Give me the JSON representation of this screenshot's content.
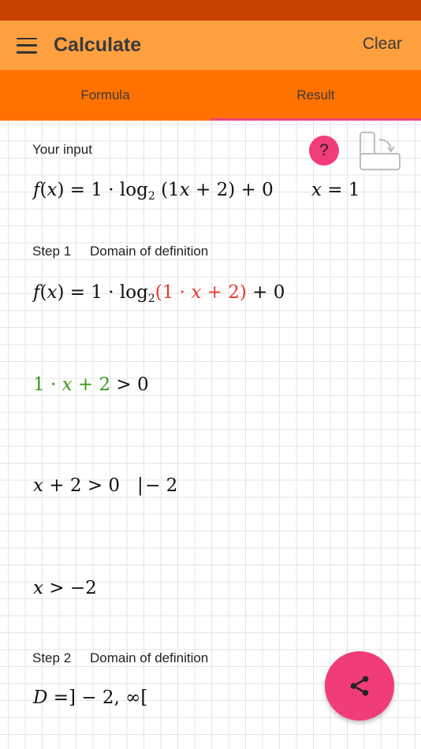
{
  "app_bar": {
    "title": "Calculate",
    "clear_label": "Clear"
  },
  "tabs": [
    {
      "label": "Formula",
      "active": false
    },
    {
      "label": "Result",
      "active": true
    }
  ],
  "your_input": {
    "label": "Your input",
    "help_label": "?"
  },
  "steps": [
    {
      "number": "Step 1",
      "title": "Domain of definition"
    },
    {
      "number": "Step 2",
      "title": "Domain of definition"
    }
  ],
  "colors": {
    "status_bar": "#c94100",
    "app_bar": "#ffa040",
    "tab_bar": "#ff7200",
    "accent": "#f03c78",
    "highlight_red": "#e53935",
    "highlight_green": "#3a9a1c"
  },
  "icons": {
    "menu": "menu-icon",
    "help": "help-icon",
    "rotate": "rotate-screen-icon",
    "share": "share-icon"
  }
}
